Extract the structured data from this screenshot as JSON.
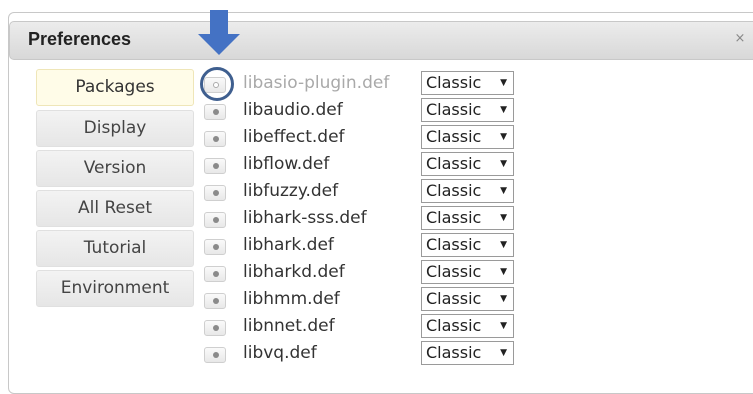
{
  "window": {
    "title": "Preferences",
    "close_symbol": "×"
  },
  "tabs": [
    {
      "label": "Packages",
      "active": true
    },
    {
      "label": "Display"
    },
    {
      "label": "Version"
    },
    {
      "label": "All Reset"
    },
    {
      "label": "Tutorial"
    },
    {
      "label": "Environment"
    }
  ],
  "packages": [
    {
      "name": "libasio-plugin.def",
      "mode": "Classic",
      "disabled": true
    },
    {
      "name": "libaudio.def",
      "mode": "Classic"
    },
    {
      "name": "libeffect.def",
      "mode": "Classic"
    },
    {
      "name": "libflow.def",
      "mode": "Classic"
    },
    {
      "name": "libfuzzy.def",
      "mode": "Classic"
    },
    {
      "name": "libhark-sss.def",
      "mode": "Classic"
    },
    {
      "name": "libhark.def",
      "mode": "Classic"
    },
    {
      "name": "libharkd.def",
      "mode": "Classic"
    },
    {
      "name": "libhmm.def",
      "mode": "Classic"
    },
    {
      "name": "libnnet.def",
      "mode": "Classic"
    },
    {
      "name": "libvq.def",
      "mode": "Classic"
    }
  ],
  "select_caret": "▼",
  "annotation": {
    "arrow_color": "#4472c4",
    "circle_color": "#3f5f8f"
  }
}
